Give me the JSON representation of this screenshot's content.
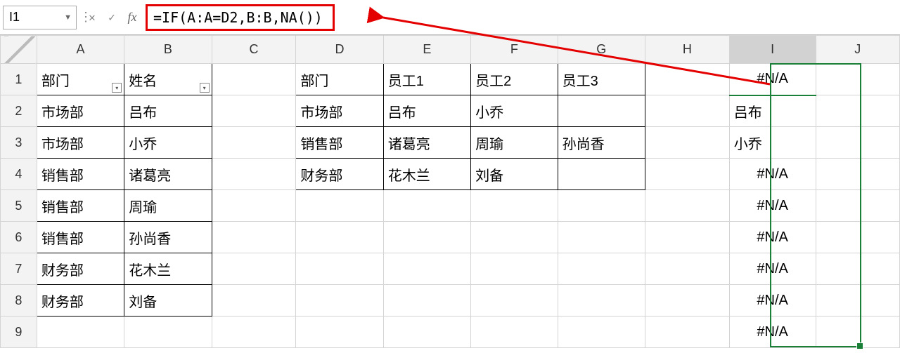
{
  "formula_bar": {
    "cell_ref": "I1",
    "formula": "=IF(A:A=D2,B:B,NA())"
  },
  "column_headers": [
    "A",
    "B",
    "C",
    "D",
    "E",
    "F",
    "G",
    "H",
    "I",
    "J"
  ],
  "row_headers": [
    "1",
    "2",
    "3",
    "4",
    "5",
    "6",
    "7",
    "8",
    "9"
  ],
  "selected_column": "I",
  "tableAB": {
    "head": {
      "dept": "部门",
      "name": "姓名"
    },
    "rows": [
      {
        "dept": "市场部",
        "name": "吕布"
      },
      {
        "dept": "市场部",
        "name": "小乔"
      },
      {
        "dept": "销售部",
        "name": "诸葛亮"
      },
      {
        "dept": "销售部",
        "name": "周瑜"
      },
      {
        "dept": "销售部",
        "name": "孙尚香"
      },
      {
        "dept": "财务部",
        "name": "花木兰"
      },
      {
        "dept": "财务部",
        "name": "刘备"
      }
    ]
  },
  "tableDG": {
    "head": {
      "dept": "部门",
      "e1": "员工1",
      "e2": "员工2",
      "e3": "员工3"
    },
    "rows": [
      {
        "dept": "市场部",
        "e1": "吕布",
        "e2": "小乔",
        "e3": ""
      },
      {
        "dept": "销售部",
        "e1": "诸葛亮",
        "e2": "周瑜",
        "e3": "孙尚香"
      },
      {
        "dept": "财务部",
        "e1": "花木兰",
        "e2": "刘备",
        "e3": ""
      }
    ]
  },
  "columnI": {
    "values": [
      "#N/A",
      "吕布",
      "小乔",
      "#N/A",
      "#N/A",
      "#N/A",
      "#N/A",
      "#N/A",
      "#N/A"
    ],
    "align": [
      "center",
      "left",
      "left",
      "center",
      "center",
      "center",
      "center",
      "center",
      "center"
    ]
  }
}
